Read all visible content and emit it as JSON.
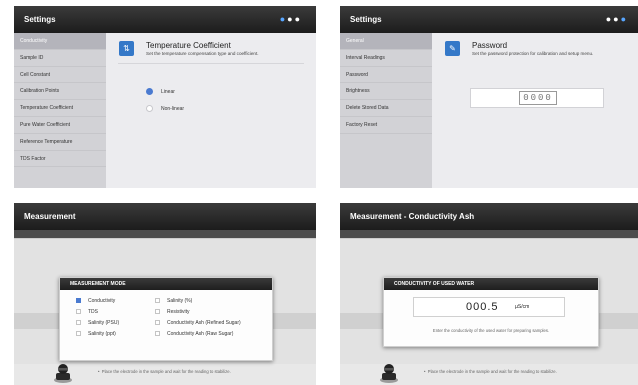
{
  "screen1": {
    "title": "Settings",
    "sidebar": [
      "Conductivity",
      "Sample ID",
      "Cell Constant",
      "Calibration Points",
      "Temperature Coefficient",
      "Pure Water Coefficient",
      "Reference Temperature",
      "TDS Factor"
    ],
    "selected_index": 0,
    "heading": "Temperature Coefficient",
    "description": "Set the temperature compensation type and coefficient.",
    "options": [
      "Linear",
      "Non-linear"
    ],
    "selected_option": "Linear"
  },
  "screen2": {
    "title": "Settings",
    "sidebar": [
      "General",
      "Interval Readings",
      "Password",
      "Brightness",
      "Delete Stored Data",
      "Factory Reset"
    ],
    "selected_index": 0,
    "heading": "Password",
    "description": "Set the password protection for calibration and setup menu.",
    "pin": "0000"
  },
  "screen3": {
    "title": "Measurement",
    "dialog_title": "MEASUREMENT MODE",
    "left_options": [
      "Conductivity",
      "TDS",
      "Salinity (PSU)",
      "Salinity (ppt)"
    ],
    "right_options": [
      "Salinity (%)",
      "Resistivity",
      "Conductivity Ash (Refined Sugar)",
      "Conductivity Ash (Raw Sugar)"
    ],
    "selected": "Conductivity",
    "hint": "Place the electrode in the sample and wait for the reading to stabilize."
  },
  "screen4": {
    "title": "Measurement - Conductivity Ash",
    "dialog_title": "CONDUCTIVITY OF USED WATER",
    "value": "000.5",
    "unit": "µS/cm",
    "dialog_hint": "Enter the conductivity of the used water for preparing samples.",
    "hint": "Place the electrode in the sample and wait for the reading to stabilize."
  },
  "colors": {
    "accent": "#3478c8",
    "titlebar": "#262626",
    "selected_item": "#b4b4bb"
  }
}
